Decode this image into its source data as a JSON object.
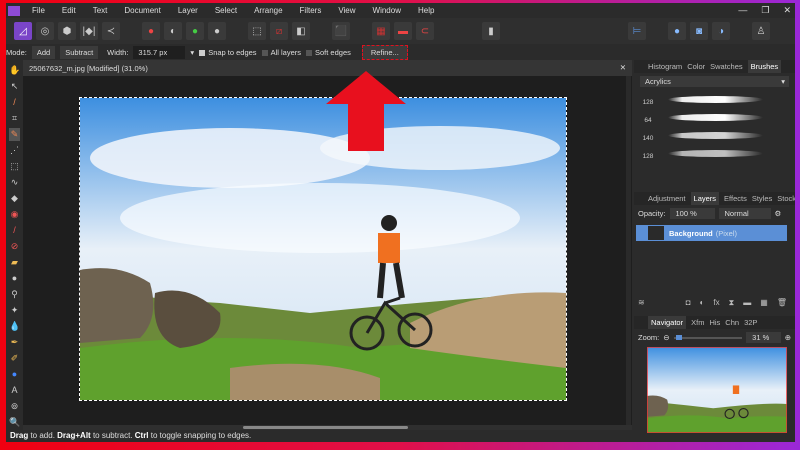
{
  "menu": [
    "File",
    "Edit",
    "Text",
    "Document",
    "Layer",
    "Select",
    "Arrange",
    "Filters",
    "View",
    "Window",
    "Help"
  ],
  "window_controls": [
    "—",
    "❐",
    "✕"
  ],
  "context": {
    "mode_label": "Mode:",
    "add": "Add",
    "subtract": "Subtract",
    "width_label": "Width:",
    "width_value": "315.7 px",
    "snap": "Snap to edges",
    "snap_checked": true,
    "all_layers": "All layers",
    "all_layers_checked": false,
    "soft_edges": "Soft edges",
    "soft_edges_checked": false,
    "refine": "Refine..."
  },
  "document_tab": {
    "title": "25067632_m.jpg [Modified] (31.0%)",
    "close": "✕"
  },
  "brushes_panel": {
    "tabs": [
      "Histogram",
      "Color",
      "Swatches",
      "Brushes"
    ],
    "active": "Brushes",
    "category": "Acrylics",
    "brushes": [
      "128",
      "64",
      "140",
      "128"
    ]
  },
  "layers_panel": {
    "tabs": [
      "Adjustment",
      "Layers",
      "Effects",
      "Styles",
      "Stock"
    ],
    "active": "Layers",
    "opacity_label": "Opacity:",
    "opacity": "100 %",
    "blend": "Normal",
    "layer_name": "Background",
    "layer_type": "(Pixel)"
  },
  "navigator_panel": {
    "tabs": [
      "Navigator",
      "Xfm",
      "His",
      "Chn",
      "32P"
    ],
    "active": "Navigator",
    "zoom_label": "Zoom:",
    "zoom_value": "31 %"
  },
  "status": {
    "drag": "Drag",
    "t1": " to add. ",
    "dragalt": "Drag+Alt",
    "t2": " to subtract. ",
    "ctrl": "Ctrl",
    "t3": " to toggle snapping to edges."
  },
  "colors": {
    "accent": "#5b8fd6",
    "highlight": "#e0101e",
    "persona": "#7a45c8"
  }
}
